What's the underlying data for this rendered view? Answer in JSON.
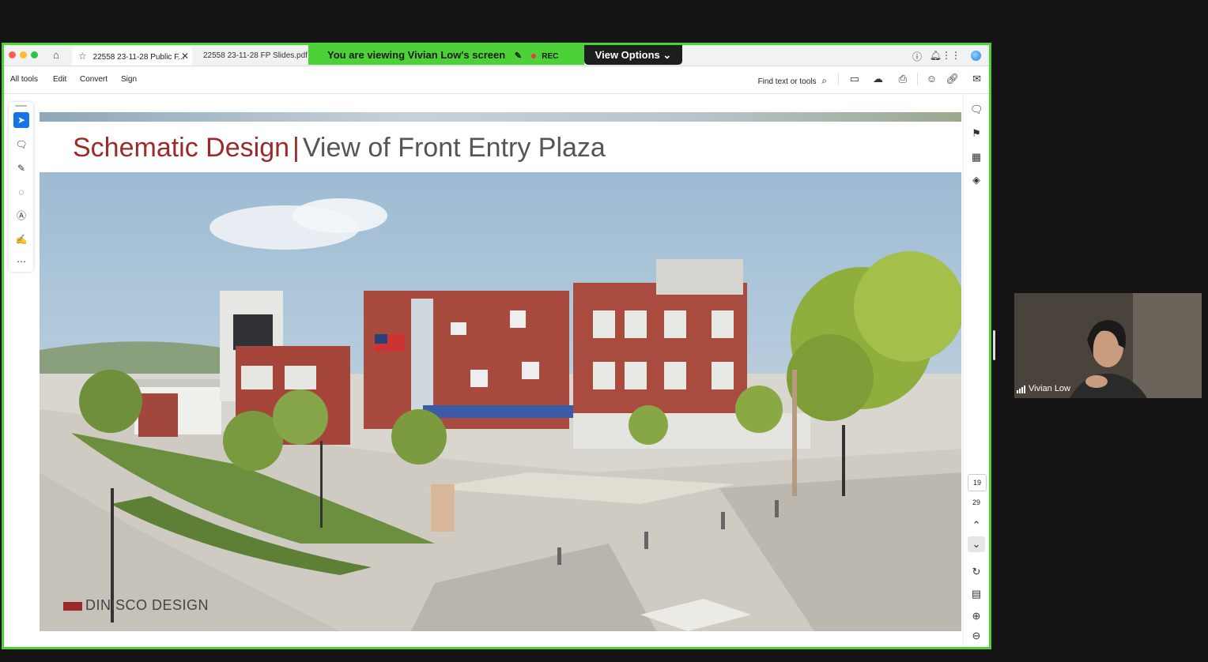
{
  "tabs": {
    "active_label": "22558 23-11-28 Public F...",
    "second_label": "22558 23-11-28 FP Slides.pdf"
  },
  "share_banner": {
    "prefix": "You are viewing",
    "name": "Vivian Low's screen",
    "rec": "REC",
    "view_options": "View Options"
  },
  "toolbar": {
    "all_tools": "All tools",
    "edit": "Edit",
    "convert": "Convert",
    "sign": "Sign",
    "find": "Find text or tools"
  },
  "slide": {
    "title_main": "Schematic Design",
    "title_sep": "|",
    "title_sub": "View of Front Entry Plaza",
    "logo_text": "DINISCO DESIGN"
  },
  "page_nav": {
    "current": "19",
    "total": "29"
  },
  "participant": {
    "name": "Vivian Low"
  },
  "colors": {
    "share_green": "#4cd137",
    "title_red": "#9c2a2a",
    "accent_blue": "#1473e6"
  }
}
